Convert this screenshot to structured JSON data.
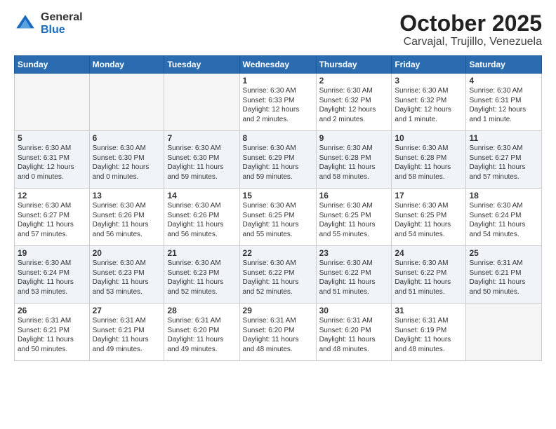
{
  "logo": {
    "general": "General",
    "blue": "Blue"
  },
  "header": {
    "month": "October 2025",
    "location": "Carvajal, Trujillo, Venezuela"
  },
  "weekdays": [
    "Sunday",
    "Monday",
    "Tuesday",
    "Wednesday",
    "Thursday",
    "Friday",
    "Saturday"
  ],
  "weeks": [
    [
      {
        "day": "",
        "info": ""
      },
      {
        "day": "",
        "info": ""
      },
      {
        "day": "",
        "info": ""
      },
      {
        "day": "1",
        "info": "Sunrise: 6:30 AM\nSunset: 6:33 PM\nDaylight: 12 hours\nand 2 minutes."
      },
      {
        "day": "2",
        "info": "Sunrise: 6:30 AM\nSunset: 6:32 PM\nDaylight: 12 hours\nand 2 minutes."
      },
      {
        "day": "3",
        "info": "Sunrise: 6:30 AM\nSunset: 6:32 PM\nDaylight: 12 hours\nand 1 minute."
      },
      {
        "day": "4",
        "info": "Sunrise: 6:30 AM\nSunset: 6:31 PM\nDaylight: 12 hours\nand 1 minute."
      }
    ],
    [
      {
        "day": "5",
        "info": "Sunrise: 6:30 AM\nSunset: 6:31 PM\nDaylight: 12 hours\nand 0 minutes."
      },
      {
        "day": "6",
        "info": "Sunrise: 6:30 AM\nSunset: 6:30 PM\nDaylight: 12 hours\nand 0 minutes."
      },
      {
        "day": "7",
        "info": "Sunrise: 6:30 AM\nSunset: 6:30 PM\nDaylight: 11 hours\nand 59 minutes."
      },
      {
        "day": "8",
        "info": "Sunrise: 6:30 AM\nSunset: 6:29 PM\nDaylight: 11 hours\nand 59 minutes."
      },
      {
        "day": "9",
        "info": "Sunrise: 6:30 AM\nSunset: 6:28 PM\nDaylight: 11 hours\nand 58 minutes."
      },
      {
        "day": "10",
        "info": "Sunrise: 6:30 AM\nSunset: 6:28 PM\nDaylight: 11 hours\nand 58 minutes."
      },
      {
        "day": "11",
        "info": "Sunrise: 6:30 AM\nSunset: 6:27 PM\nDaylight: 11 hours\nand 57 minutes."
      }
    ],
    [
      {
        "day": "12",
        "info": "Sunrise: 6:30 AM\nSunset: 6:27 PM\nDaylight: 11 hours\nand 57 minutes."
      },
      {
        "day": "13",
        "info": "Sunrise: 6:30 AM\nSunset: 6:26 PM\nDaylight: 11 hours\nand 56 minutes."
      },
      {
        "day": "14",
        "info": "Sunrise: 6:30 AM\nSunset: 6:26 PM\nDaylight: 11 hours\nand 56 minutes."
      },
      {
        "day": "15",
        "info": "Sunrise: 6:30 AM\nSunset: 6:25 PM\nDaylight: 11 hours\nand 55 minutes."
      },
      {
        "day": "16",
        "info": "Sunrise: 6:30 AM\nSunset: 6:25 PM\nDaylight: 11 hours\nand 55 minutes."
      },
      {
        "day": "17",
        "info": "Sunrise: 6:30 AM\nSunset: 6:25 PM\nDaylight: 11 hours\nand 54 minutes."
      },
      {
        "day": "18",
        "info": "Sunrise: 6:30 AM\nSunset: 6:24 PM\nDaylight: 11 hours\nand 54 minutes."
      }
    ],
    [
      {
        "day": "19",
        "info": "Sunrise: 6:30 AM\nSunset: 6:24 PM\nDaylight: 11 hours\nand 53 minutes."
      },
      {
        "day": "20",
        "info": "Sunrise: 6:30 AM\nSunset: 6:23 PM\nDaylight: 11 hours\nand 53 minutes."
      },
      {
        "day": "21",
        "info": "Sunrise: 6:30 AM\nSunset: 6:23 PM\nDaylight: 11 hours\nand 52 minutes."
      },
      {
        "day": "22",
        "info": "Sunrise: 6:30 AM\nSunset: 6:22 PM\nDaylight: 11 hours\nand 52 minutes."
      },
      {
        "day": "23",
        "info": "Sunrise: 6:30 AM\nSunset: 6:22 PM\nDaylight: 11 hours\nand 51 minutes."
      },
      {
        "day": "24",
        "info": "Sunrise: 6:30 AM\nSunset: 6:22 PM\nDaylight: 11 hours\nand 51 minutes."
      },
      {
        "day": "25",
        "info": "Sunrise: 6:31 AM\nSunset: 6:21 PM\nDaylight: 11 hours\nand 50 minutes."
      }
    ],
    [
      {
        "day": "26",
        "info": "Sunrise: 6:31 AM\nSunset: 6:21 PM\nDaylight: 11 hours\nand 50 minutes."
      },
      {
        "day": "27",
        "info": "Sunrise: 6:31 AM\nSunset: 6:21 PM\nDaylight: 11 hours\nand 49 minutes."
      },
      {
        "day": "28",
        "info": "Sunrise: 6:31 AM\nSunset: 6:20 PM\nDaylight: 11 hours\nand 49 minutes."
      },
      {
        "day": "29",
        "info": "Sunrise: 6:31 AM\nSunset: 6:20 PM\nDaylight: 11 hours\nand 48 minutes."
      },
      {
        "day": "30",
        "info": "Sunrise: 6:31 AM\nSunset: 6:20 PM\nDaylight: 11 hours\nand 48 minutes."
      },
      {
        "day": "31",
        "info": "Sunrise: 6:31 AM\nSunset: 6:19 PM\nDaylight: 11 hours\nand 48 minutes."
      },
      {
        "day": "",
        "info": ""
      }
    ]
  ]
}
